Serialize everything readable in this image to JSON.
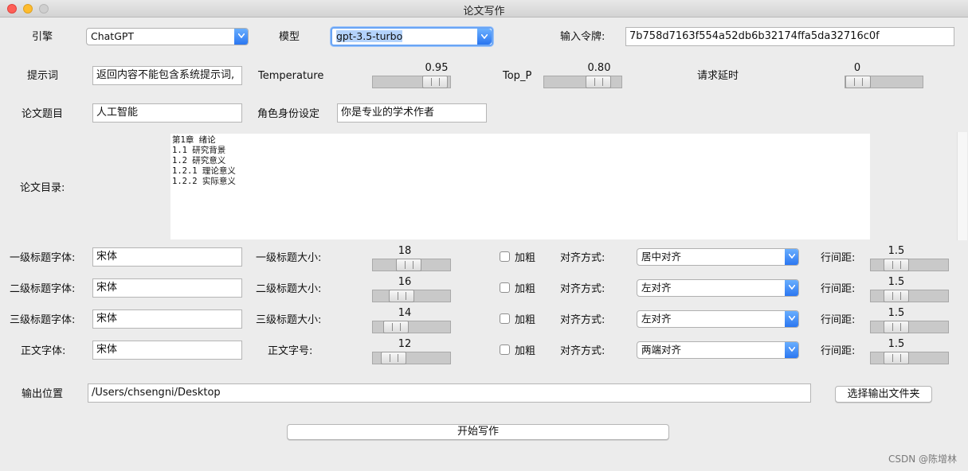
{
  "window": {
    "title": "论文写作"
  },
  "engine": {
    "label": "引擎",
    "value": "ChatGPT"
  },
  "model": {
    "label": "模型",
    "value": "gpt-3.5-turbo"
  },
  "token": {
    "label": "输入令牌:",
    "value": "7b758d7163f554a52db6b32174ffa5da32716c0f"
  },
  "prompt": {
    "label": "提示词",
    "value": "返回内容不能包含系统提示词,"
  },
  "temperature": {
    "label": "Temperature",
    "value": "0.95",
    "level": 0.95
  },
  "top_p": {
    "label": "Top_P",
    "value": "0.80",
    "level": 0.8
  },
  "delay": {
    "label": "请求延时",
    "value": "0",
    "level": 0.0
  },
  "thesis_title": {
    "label": "论文题目",
    "value": "人工智能"
  },
  "role": {
    "label": "角色身份设定",
    "value": "你是专业的学术作者"
  },
  "toc": {
    "label": "论文目录:",
    "text": "第1章 绪论\n1.1 研究背景\n1.2 研究意义\n1.2.1 理论意义\n1.2.2 实际意义"
  },
  "rows": [
    {
      "font_label": "一级标题字体:",
      "font": "宋体",
      "size_label": "一级标题大小:",
      "size": "18",
      "bold_label": "加粗",
      "align_label": "对齐方式:",
      "align": "居中对齐",
      "spacing_label": "行间距:",
      "spacing": "1.5"
    },
    {
      "font_label": "二级标题字体:",
      "font": "宋体",
      "size_label": "二级标题大小:",
      "size": "16",
      "bold_label": "加粗",
      "align_label": "对齐方式:",
      "align": "左对齐",
      "spacing_label": "行间距:",
      "spacing": "1.5"
    },
    {
      "font_label": "三级标题字体:",
      "font": "宋体",
      "size_label": "三级标题大小:",
      "size": "14",
      "bold_label": "加粗",
      "align_label": "对齐方式:",
      "align": "左对齐",
      "spacing_label": "行间距:",
      "spacing": "1.5"
    },
    {
      "font_label": "正文字体:",
      "font": "宋体",
      "size_label": "正文字号:",
      "size": "12",
      "bold_label": "加粗",
      "align_label": "对齐方式:",
      "align": "两端对齐",
      "spacing_label": "行间距:",
      "spacing": "1.5"
    }
  ],
  "output": {
    "label": "输出位置",
    "value": "/Users/chsengni/Desktop",
    "choose_label": "选择输出文件夹"
  },
  "start": {
    "label": "开始写作"
  },
  "watermark": "CSDN @陈增林"
}
